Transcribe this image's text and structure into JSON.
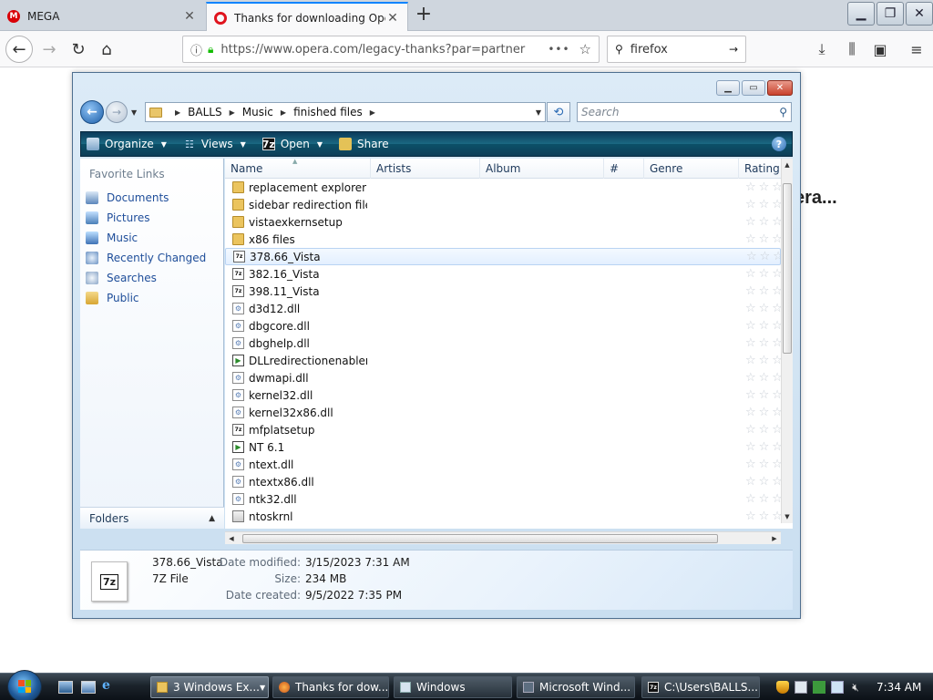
{
  "browser": {
    "tabs": [
      {
        "title": "MEGA",
        "favicon": "mega-logo-icon",
        "active": false
      },
      {
        "title": "Thanks for downloading Opera",
        "favicon": "opera-logo-icon",
        "active": true
      }
    ],
    "url": "https://www.opera.com/legacy-thanks?par=partner",
    "search_query": "firefox",
    "page_text": "era..."
  },
  "explorer": {
    "breadcrumb": [
      "BALLS",
      "Music",
      "finished files"
    ],
    "search_placeholder": "Search",
    "toolbar": {
      "organize": "Organize",
      "views": "Views",
      "open": "Open",
      "share": "Share"
    },
    "sidebar": {
      "title": "Favorite Links",
      "links": [
        "Documents",
        "Pictures",
        "Music",
        "Recently Changed",
        "Searches",
        "Public"
      ],
      "folders_label": "Folders"
    },
    "columns": [
      "Name",
      "Artists",
      "Album",
      "#",
      "Genre",
      "Rating"
    ],
    "files": [
      {
        "name": "replacement explorer",
        "type": "folder"
      },
      {
        "name": "sidebar redirection file...",
        "type": "folder"
      },
      {
        "name": "vistaexkernsetup",
        "type": "folder"
      },
      {
        "name": "x86 files",
        "type": "folder"
      },
      {
        "name": "378.66_Vista",
        "type": "7z",
        "selected": true
      },
      {
        "name": "382.16_Vista",
        "type": "7z"
      },
      {
        "name": "398.11_Vista",
        "type": "7z"
      },
      {
        "name": "d3d12.dll",
        "type": "dll"
      },
      {
        "name": "dbgcore.dll",
        "type": "dll"
      },
      {
        "name": "dbghelp.dll",
        "type": "dll"
      },
      {
        "name": "DLLredirectionenabler",
        "type": "exe"
      },
      {
        "name": "dwmapi.dll",
        "type": "dll"
      },
      {
        "name": "kernel32.dll",
        "type": "dll"
      },
      {
        "name": "kernel32x86.dll",
        "type": "dll"
      },
      {
        "name": "mfplatsetup",
        "type": "7z"
      },
      {
        "name": "NT 6.1",
        "type": "exe"
      },
      {
        "name": "ntext.dll",
        "type": "dll"
      },
      {
        "name": "ntextx86.dll",
        "type": "dll"
      },
      {
        "name": "ntk32.dll",
        "type": "dll"
      },
      {
        "name": "ntoskrnl",
        "type": "sys"
      }
    ],
    "details": {
      "name": "378.66_Vista",
      "type": "7Z File",
      "icon_label": "7z",
      "date_modified_label": "Date modified:",
      "date_modified": "3/15/2023 7:31 AM",
      "size_label": "Size:",
      "size": "234 MB",
      "date_created_label": "Date created:",
      "date_created": "9/5/2022 7:35 PM"
    }
  },
  "taskbar": {
    "buttons": [
      {
        "label": "3 Windows Ex...",
        "icon": "folder-icon",
        "grouped": true
      },
      {
        "label": "Thanks for dow...",
        "icon": "firefox-icon"
      },
      {
        "label": "Windows",
        "icon": "window-icon"
      },
      {
        "label": "Microsoft Wind...",
        "icon": "app-icon"
      },
      {
        "label": "C:\\Users\\BALLS...",
        "icon": "7zip-icon"
      }
    ],
    "clock": "7:34 AM"
  }
}
